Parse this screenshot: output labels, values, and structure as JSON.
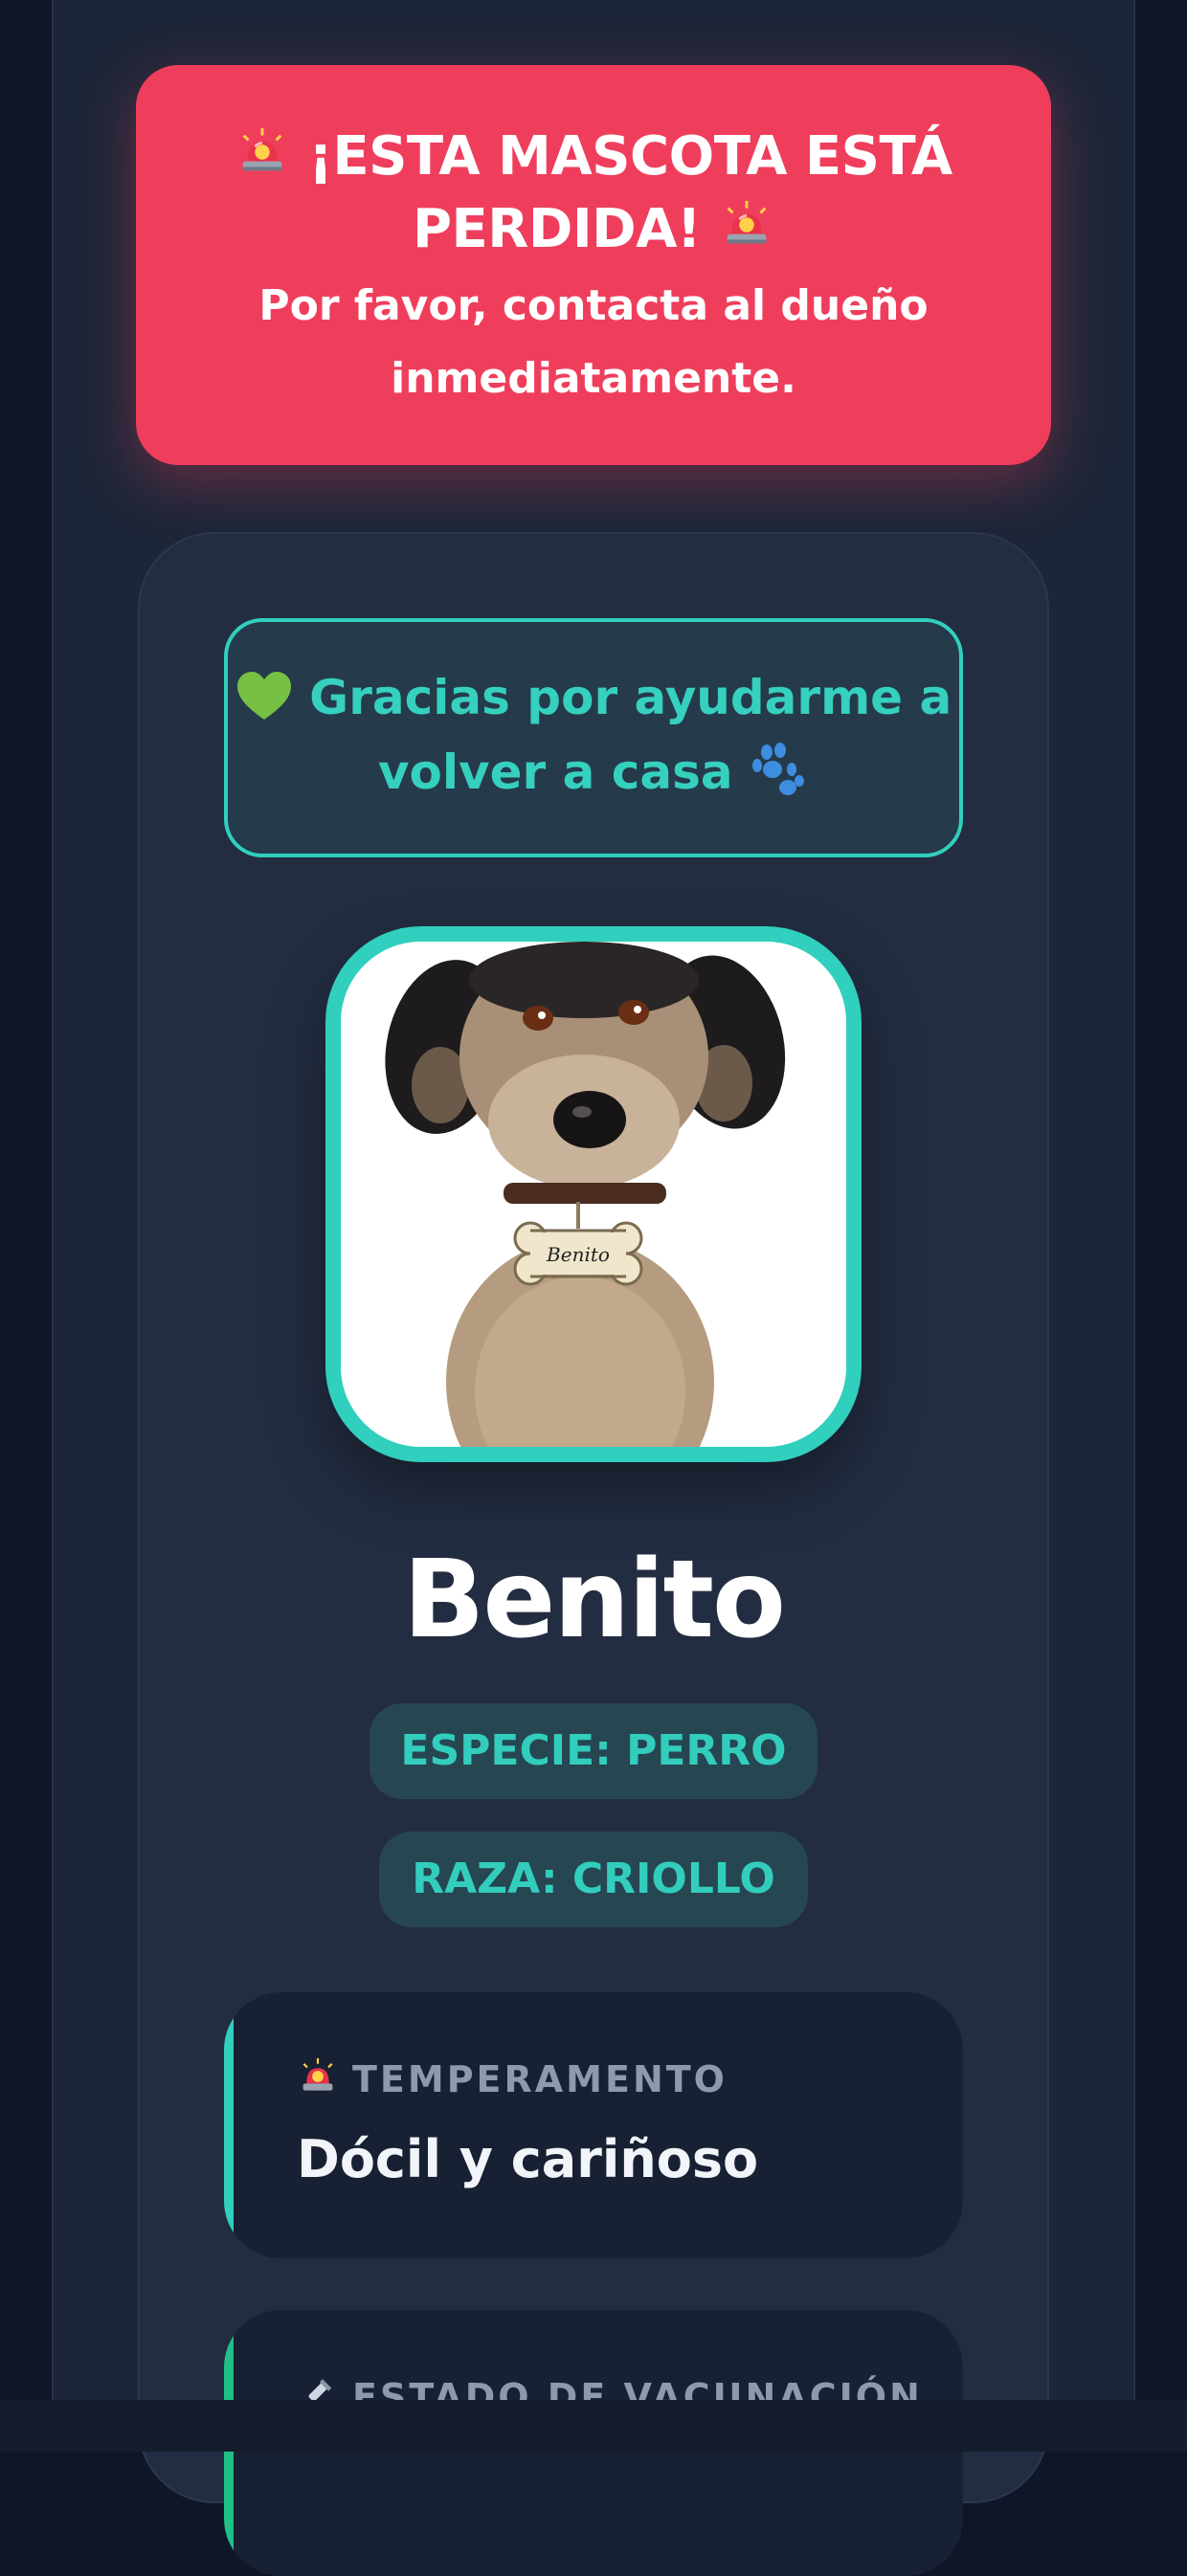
{
  "alert": {
    "title": "¡ESTA MASCOTA ESTÁ PERDIDA!",
    "subtitle": "Por favor, contacta al dueño inmediatamente.",
    "icon": "siren-icon",
    "color": "#ef3e5c"
  },
  "thanks": {
    "text": "Gracias por ayudarme a volver a casa",
    "icons": [
      "green-heart-icon",
      "paw-icon"
    ]
  },
  "pet": {
    "name": "Benito",
    "tag_text": "Benito",
    "species_pill": "ESPECIE: PERRO",
    "breed_pill": "RAZA: CRIOLLO"
  },
  "info_cards": [
    {
      "label": "TEMPERAMENTO",
      "value": "Dócil y cariñoso",
      "icon": "siren-icon"
    },
    {
      "label": "ESTADO DE VACUNACIÓN",
      "value": "",
      "icon": "syringe-icon"
    }
  ],
  "colors": {
    "accent": "#31cfbd",
    "background": "#1d2638",
    "card": "#232d41"
  }
}
